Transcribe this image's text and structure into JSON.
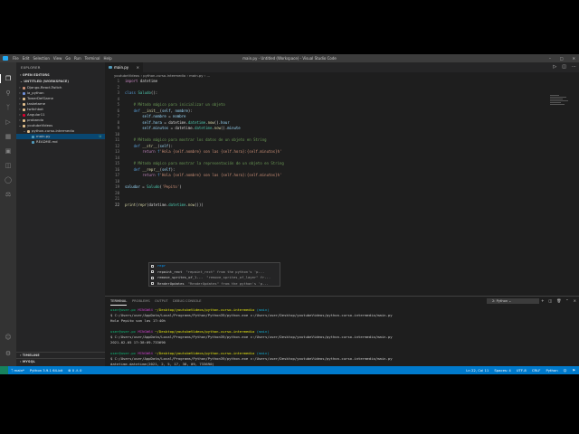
{
  "window": {
    "title": "main.py - Untitled (Workspace) - Visual Studio Code",
    "menu": [
      "File",
      "Edit",
      "Selection",
      "View",
      "Go",
      "Run",
      "Terminal",
      "Help"
    ]
  },
  "sidebar": {
    "header": "EXPLORER",
    "open_editors": "OPEN EDITORS",
    "workspace": "UNTITLED (WORKSPACE)",
    "items": [
      {
        "label": "Django-React-Twitch",
        "color": "#ce9178"
      },
      {
        "label": "ia_python",
        "color": "#6f8fd8"
      },
      {
        "label": "TowerDefGame",
        "color": "#e2c08d"
      },
      {
        "label": "tasketame",
        "color": "#e2c08d"
      },
      {
        "label": "twitchbot",
        "color": "#e2c08d"
      },
      {
        "label": "Angular11",
        "color": "#dd0031"
      },
      {
        "label": "probando",
        "color": "#e2c08d"
      },
      {
        "label": "youtubeVideos",
        "color": "#e2c08d"
      },
      {
        "label": "python-curso-intermedio",
        "color": "#e2c08d"
      },
      {
        "label": "main.py",
        "color": "#519aba",
        "badge": "U"
      },
      {
        "label": "README.md",
        "color": "#519aba"
      }
    ],
    "timeline": "TIMELINE",
    "mysql": "MYSQL"
  },
  "editor": {
    "tab_label": "main.py",
    "breadcrumb": [
      "youtubeVideos",
      "python-curso-intermedio",
      "main.py",
      "..."
    ]
  },
  "suggest": [
    {
      "name": "repr",
      "detail": ""
    },
    {
      "name": "repaint_rect",
      "detail": "\"repaint_rect\" from the python's 'p..."
    },
    {
      "name": "remove_sprites_of_l...",
      "detail": "\"remove_sprites_of_layer\" fr..."
    },
    {
      "name": "RenderUpdates",
      "detail": "\"RenderUpdates\" from the python's 'p..."
    }
  ],
  "panel": {
    "tabs": [
      "TERMINAL",
      "PROBLEMS",
      "OUTPUT",
      "DEBUG CONSOLE"
    ],
    "terminal_select": "2: Python"
  },
  "terminal": {
    "prompt_user": "user@user-pc",
    "prompt_shell": "MINGW64",
    "prompt_path": "~/Desktop/youtubeVideos/python-curso-intermedio",
    "prompt_branch": "(main)",
    "command": "$ C:/Users/user/AppData/Local/Programs/Python/Python39/python.exe c:/Users/user/Desktop/youtubeVideos/python-curso-intermedio/main.py",
    "output1": "Hola Pepito son las 17:40h",
    "output2": "2021-02-05 17:38:09.733690",
    "output3": "datetime.datetime(2021, 2, 5, 17, 38, 09, 733690)"
  },
  "status": {
    "branch": "main*",
    "python": "Python 3.9.1 64-bit",
    "errors": "0",
    "warnings": "0",
    "position": "Ln 22, Col 11",
    "spaces": "Spaces: 4",
    "encoding": "UTF-8",
    "eol": "CRLF",
    "language": "Python"
  }
}
